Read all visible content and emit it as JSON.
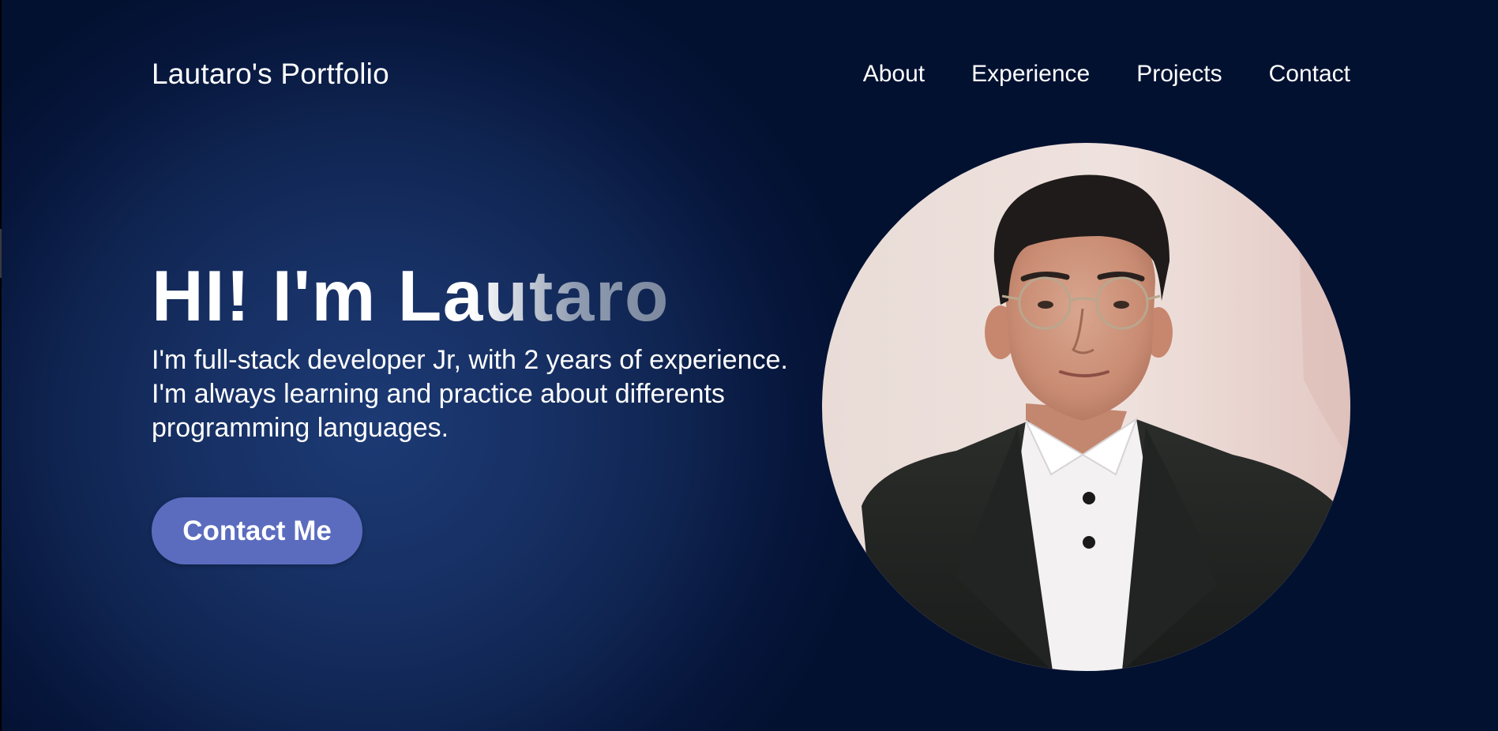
{
  "header": {
    "brand": "Lautaro's Portfolio",
    "nav": [
      {
        "label": "About"
      },
      {
        "label": "Experience"
      },
      {
        "label": "Projects"
      },
      {
        "label": "Contact"
      }
    ]
  },
  "hero": {
    "title": "HI! I'm Lautaro",
    "description": "I'm full-stack developer Jr, with 2 years of experience. I'm always learning and practice about differents programming languages.",
    "cta_label": "Contact Me"
  },
  "colors": {
    "background_dark": "#031131",
    "background_light": "#1c3a74",
    "button": "#5b6cbf",
    "text": "#ffffff"
  }
}
